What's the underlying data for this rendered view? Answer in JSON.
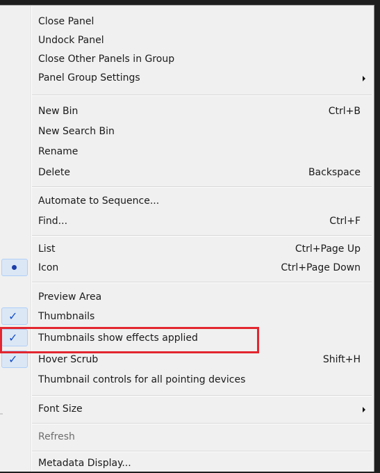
{
  "menu": {
    "close_panel": "Close Panel",
    "undock_panel": "Undock Panel",
    "close_other_panels": "Close Other Panels in Group",
    "panel_group_settings": "Panel Group Settings",
    "new_bin": {
      "label": "New Bin",
      "shortcut": "Ctrl+B"
    },
    "new_search_bin": "New Search Bin",
    "rename": "Rename",
    "delete": {
      "label": "Delete",
      "shortcut": "Backspace"
    },
    "automate_to_sequence": "Automate to Sequence...",
    "find": {
      "label": "Find...",
      "shortcut": "Ctrl+F"
    },
    "list": {
      "label": "List",
      "shortcut": "Ctrl+Page Up",
      "selected": false
    },
    "icon": {
      "label": "Icon",
      "shortcut": "Ctrl+Page Down",
      "selected": true
    },
    "preview_area": "Preview Area",
    "thumbnails": {
      "label": "Thumbnails",
      "checked": true
    },
    "thumbnails_show_effects": {
      "label": "Thumbnails show effects applied",
      "checked": true
    },
    "hover_scrub": {
      "label": "Hover Scrub",
      "shortcut": "Shift+H",
      "checked": true
    },
    "thumbnail_controls": "Thumbnail controls for all pointing devices",
    "font_size": "Font Size",
    "refresh": {
      "label": "Refresh",
      "disabled": true
    },
    "metadata_display": "Metadata Display..."
  },
  "glyphs": {
    "check": "✓"
  },
  "colors": {
    "highlight_box": "#e3262f",
    "check": "#1550c8",
    "menu_bg": "#f0f0f0"
  }
}
